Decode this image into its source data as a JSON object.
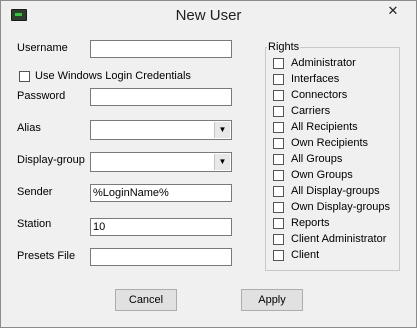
{
  "window": {
    "title": "New User",
    "close_glyph": "✕"
  },
  "form": {
    "username_label": "Username",
    "username_value": "",
    "windows_login_label": "Use Windows Login Credentials",
    "password_label": "Password",
    "password_value": "",
    "alias_label": "Alias",
    "alias_value": "",
    "display_group_label": "Display-group",
    "display_group_value": "",
    "sender_label": "Sender",
    "sender_value": "%LoginName%",
    "station_label": "Station",
    "station_value": "10",
    "presets_label": "Presets File",
    "presets_value": ""
  },
  "rights": {
    "title": "Rights",
    "items": [
      "Administrator",
      "Interfaces",
      "Connectors",
      "Carriers",
      "All Recipients",
      "Own Recipients",
      "All Groups",
      "Own Groups",
      "All Display-groups",
      "Own Display-groups",
      "Reports",
      "Client Administrator",
      "Client"
    ]
  },
  "buttons": {
    "cancel": "Cancel",
    "apply": "Apply"
  },
  "icons": {
    "app": "app-icon",
    "dropdown": "chevron-down-icon"
  }
}
